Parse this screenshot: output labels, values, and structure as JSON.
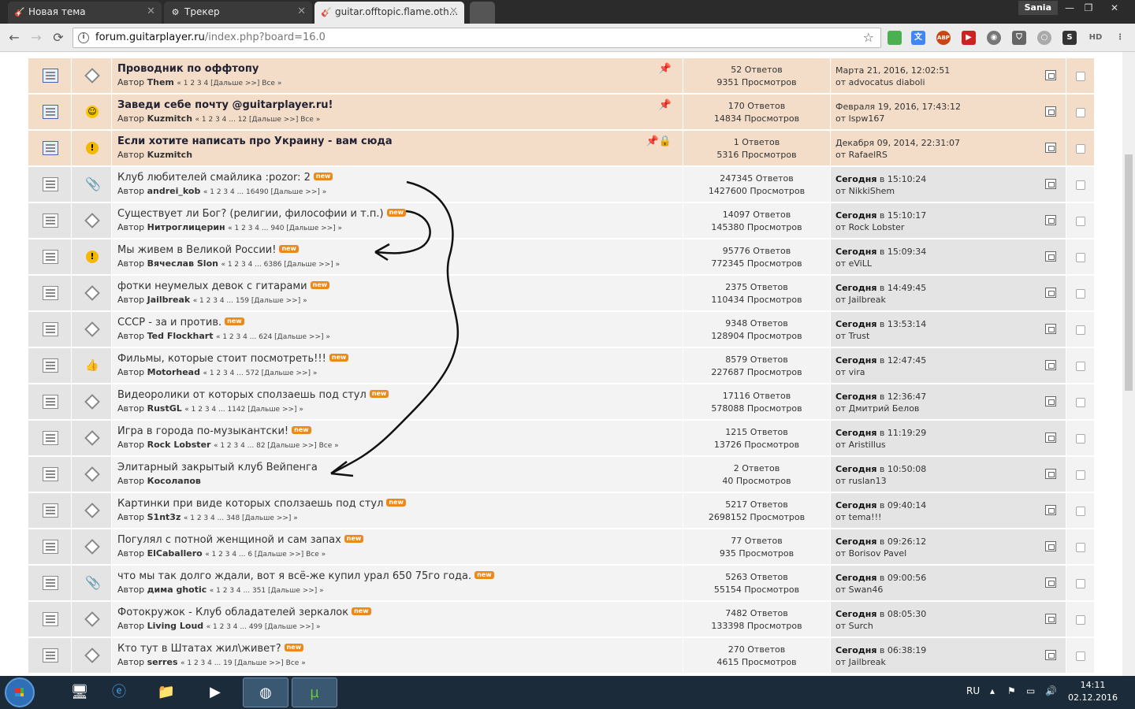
{
  "browser": {
    "tabs": [
      {
        "label": "Новая тема",
        "icon": "guitar-favicon"
      },
      {
        "label": "Трекер",
        "icon": "tracker-favicon"
      },
      {
        "label": "guitar.offtopic.flame.oth...",
        "icon": "guitar-favicon"
      }
    ],
    "user": "Sania",
    "address": {
      "host": "forum.guitarplayer.ru",
      "path": "/index.php?board=16.0"
    },
    "extensions": [
      "ABP",
      "2",
      "HD"
    ]
  },
  "topics": [
    {
      "title": "Проводник по оффтопу",
      "author": "Them",
      "pages": "« 1 2 3 4 [Дальше >>]  Все »",
      "replies": "52 Ответов",
      "views": "9351 Просмотров",
      "last_time": "Марта 21, 2016, 12:02:51",
      "last_by": "от advocatus diaboli",
      "sticky": true
    },
    {
      "title": "Заведи себе почту @guitarplayer.ru!",
      "author": "Kuzmitch",
      "pages": "« 1 2 3 4 ... 12 [Дальше >>]  Все »",
      "replies": "170 Ответов",
      "views": "14834 Просмотров",
      "last_time": "Февраля 19, 2016, 17:43:12",
      "last_by": "от lspw167",
      "sticky": true
    },
    {
      "title": "Если хотите написать про Украину - вам сюда",
      "author": "Kuzmitch",
      "pages": "",
      "replies": "1 Ответов",
      "views": "5316 Просмотров",
      "last_time": "Декабря 09, 2014, 22:31:07",
      "last_by": "от RafaelRS",
      "sticky": true
    },
    {
      "title": "Клуб любителей смайлика :pozor: 2",
      "author": "andrei_kob",
      "pages": "« 1 2 3 4 ... 16490 [Дальше >>] »",
      "replies": "247345 Ответов",
      "views": "1427600 Просмотров",
      "today": "Сегодня",
      "last_time": " в 15:10:24",
      "last_by": "от NikkiShem"
    },
    {
      "title": "Существует ли Бог? (религии, философии и т.п.)",
      "author": "Нитроглицерин",
      "pages": "« 1 2 3 4 ... 940 [Дальше >>] »",
      "replies": "14097 Ответов",
      "views": "145380 Просмотров",
      "today": "Сегодня",
      "last_time": " в 15:10:17",
      "last_by": "от Rock Lobster"
    },
    {
      "title": "Мы живем в Великой России!",
      "author": "Вячеслав Slon",
      "pages": "« 1 2 3 4 ... 6386 [Дальше >>] »",
      "replies": "95776 Ответов",
      "views": "772345 Просмотров",
      "today": "Сегодня",
      "last_time": " в 15:09:34",
      "last_by": "от eViLL"
    },
    {
      "title": "фотки неумелых девок с гитарами",
      "author": "Jailbreak",
      "pages": "« 1 2 3 4 ... 159 [Дальше >>] »",
      "replies": "2375 Ответов",
      "views": "110434 Просмотров",
      "today": "Сегодня",
      "last_time": " в 14:49:45",
      "last_by": "от Jailbreak"
    },
    {
      "title": "СССР - за и против.",
      "author": "Ted Flockhart",
      "pages": "« 1 2 3 4 ... 624 [Дальше >>] »",
      "replies": "9348 Ответов",
      "views": "128904 Просмотров",
      "today": "Сегодня",
      "last_time": " в 13:53:14",
      "last_by": "от Trust"
    },
    {
      "title": "Фильмы, которые стоит посмотреть!!!",
      "author": "Motorhead",
      "pages": "« 1 2 3 4 ... 572 [Дальше >>] »",
      "replies": "8579 Ответов",
      "views": "227687 Просмотров",
      "today": "Сегодня",
      "last_time": " в 12:47:45",
      "last_by": "от vira"
    },
    {
      "title": "Видеоролики от которых сползаешь под стул",
      "author": "RustGL",
      "pages": "« 1 2 3 4 ... 1142 [Дальше >>] »",
      "replies": "17116 Ответов",
      "views": "578088 Просмотров",
      "today": "Сегодня",
      "last_time": " в 12:36:47",
      "last_by": "от Дмитрий Белов"
    },
    {
      "title": "Игра в города по-музыкантски!",
      "author": "Rock Lobster",
      "pages": "« 1 2 3 4 ... 82 [Дальше >>]  Все »",
      "replies": "1215 Ответов",
      "views": "13726 Просмотров",
      "today": "Сегодня",
      "last_time": " в 11:19:29",
      "last_by": "от Aristillus"
    },
    {
      "title": "Элитарный закрытый клуб Вейпенга",
      "author": "Косолапов",
      "pages": "",
      "replies": "2 Ответов",
      "views": "40 Просмотров",
      "today": "Сегодня",
      "last_time": " в 10:50:08",
      "last_by": "от ruslan13"
    },
    {
      "title": "Картинки при виде которых сползаешь под стул",
      "author": "S1nt3z",
      "pages": "« 1 2 3 4 ... 348 [Дальше >>] »",
      "replies": "5217 Ответов",
      "views": "2698152 Просмотров",
      "today": "Сегодня",
      "last_time": " в 09:40:14",
      "last_by": "от tema!!!"
    },
    {
      "title": "Погулял с потной женщиной и сам запах",
      "author": "ElCaballero",
      "pages": "« 1 2 3 4 ... 6 [Дальше >>]  Все »",
      "replies": "77 Ответов",
      "views": "935 Просмотров",
      "today": "Сегодня",
      "last_time": " в 09:26:12",
      "last_by": "от Borisov Pavel"
    },
    {
      "title": "что мы так долго ждали, вот я всё-же купил урал 650 75го года.",
      "author": "дима ghotic",
      "pages": "« 1 2 3 4 ... 351 [Дальше >>] »",
      "replies": "5263 Ответов",
      "views": "55154 Просмотров",
      "today": "Сегодня",
      "last_time": " в 09:00:56",
      "last_by": "от Swan46"
    },
    {
      "title": "Фотокружок - Клуб обладателей зеркалок",
      "author": "Living Loud",
      "pages": "« 1 2 3 4 ... 499 [Дальше >>] »",
      "replies": "7482 Ответов",
      "views": "133398 Просмотров",
      "today": "Сегодня",
      "last_time": " в 08:05:30",
      "last_by": "от Surch"
    },
    {
      "title": "Кто тут в Штатах жил\\живет?",
      "author": "serres",
      "pages": "« 1 2 3 4 ... 19 [Дальше >>]  Все »",
      "replies": "270 Ответов",
      "views": "4615 Просмотров",
      "today": "Сегодня",
      "last_time": " в 06:38:19",
      "last_by": "от Jailbreak"
    }
  ],
  "labels": {
    "author_prefix": "Автор ",
    "new_badge": "new"
  },
  "taskbar": {
    "lang": "RU",
    "time": "14:11",
    "date": "02.12.2016"
  }
}
